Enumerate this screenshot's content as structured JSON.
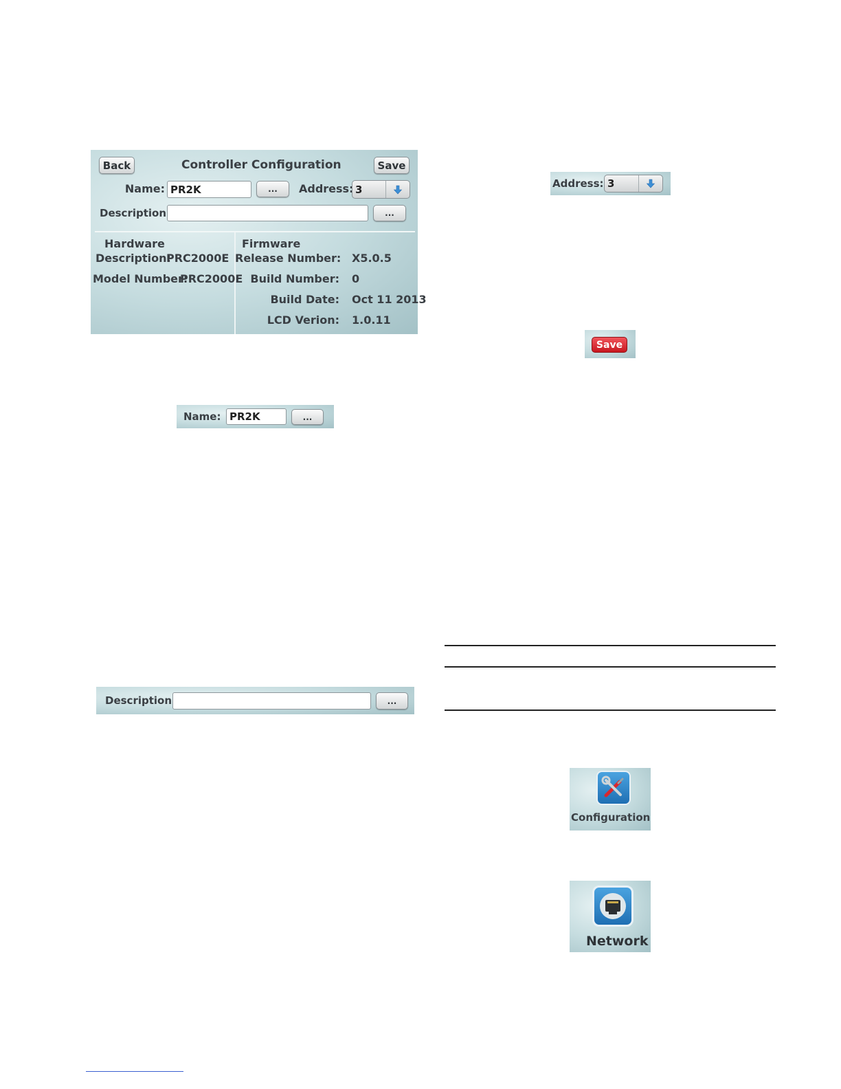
{
  "config_screen": {
    "back_label": "Back",
    "title": "Controller Configuration",
    "save_label": "Save",
    "name_label": "Name:",
    "name_value": "PR2K",
    "ellipsis_label": "...",
    "address_label": "Address:",
    "address_value": "3",
    "description_label": "Description:",
    "description_value": "",
    "hardware": {
      "heading": "Hardware",
      "description_label": "Description:",
      "description_value": "PRC2000E",
      "model_label": "Model Number:",
      "model_value": "PRC2000E"
    },
    "firmware": {
      "heading": "Firmware",
      "release_label": "Release Number:",
      "release_value": "X5.0.5",
      "build_number_label": "Build Number:",
      "build_number_value": "0",
      "build_date_label": "Build Date:",
      "build_date_value": "Oct 11 2013",
      "lcd_label": "LCD Verion:",
      "lcd_value": "1.0.11"
    }
  },
  "name_snippet": {
    "label": "Name:",
    "value": "PR2K",
    "button_label": "..."
  },
  "description_snippet": {
    "label": "Description:",
    "value": "",
    "button_label": "..."
  },
  "address_snippet": {
    "label": "Address:",
    "value": "3"
  },
  "save_snippet": {
    "label": "Save"
  },
  "configuration_icon": {
    "label": "Configuration",
    "icon": "wrench-screwdriver-icon"
  },
  "network_icon": {
    "label": "Network",
    "icon": "ethernet-port-icon"
  },
  "colors": {
    "save_red": "#d9222b",
    "arrow_blue": "#3d8fd6",
    "icon_blue": "#2f86c9"
  }
}
